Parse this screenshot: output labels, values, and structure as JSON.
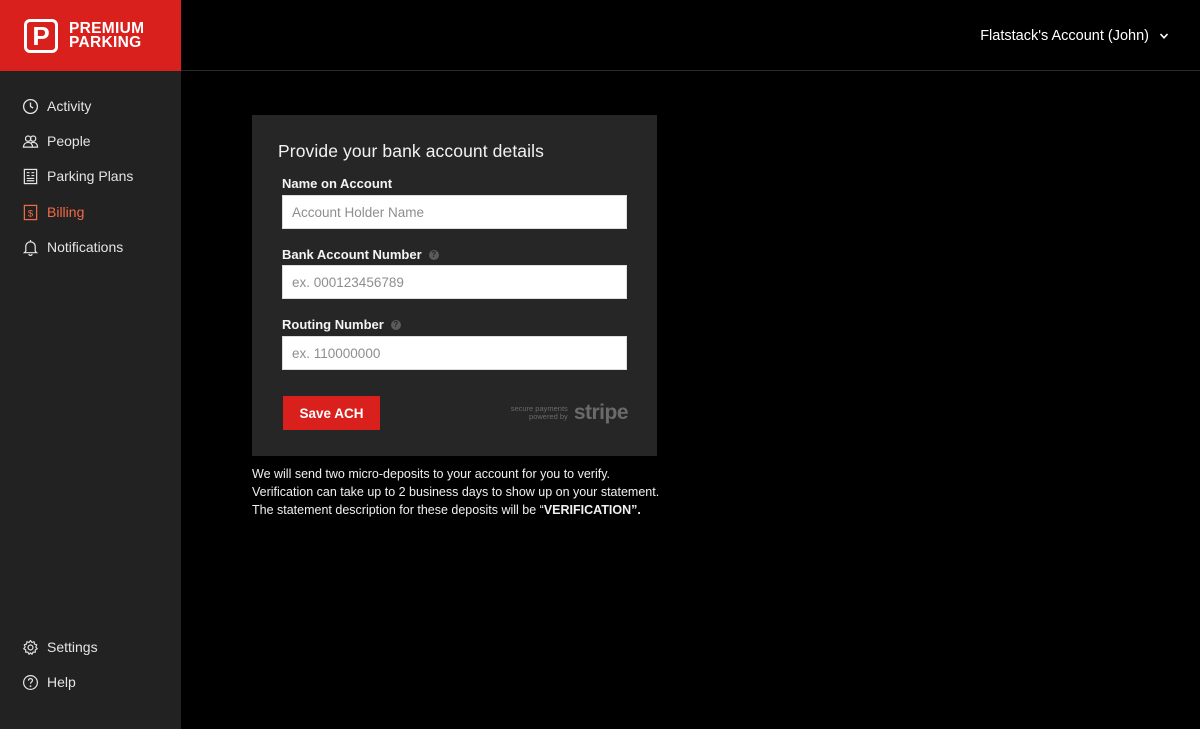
{
  "logo": {
    "mark": "P",
    "line1": "PREMIUM",
    "line2": "PARKING"
  },
  "header": {
    "account_label": "Flatstack's Account (John)"
  },
  "sidebar": {
    "items": [
      {
        "label": "Activity",
        "icon": "clock-icon"
      },
      {
        "label": "People",
        "icon": "people-icon"
      },
      {
        "label": "Parking Plans",
        "icon": "document-icon"
      },
      {
        "label": "Billing",
        "icon": "receipt-icon",
        "active": true
      },
      {
        "label": "Notifications",
        "icon": "bell-icon"
      }
    ],
    "bottom_items": [
      {
        "label": "Settings",
        "icon": "gear-icon"
      },
      {
        "label": "Help",
        "icon": "help-circle-icon"
      }
    ]
  },
  "form": {
    "title": "Provide your bank account details",
    "name": {
      "label": "Name on Account",
      "placeholder": "Account Holder Name",
      "value": ""
    },
    "account_number": {
      "label": "Bank Account Number",
      "placeholder": "ex. 000123456789",
      "value": ""
    },
    "routing_number": {
      "label": "Routing Number",
      "placeholder": "ex. 110000000",
      "value": ""
    },
    "help_glyph": "?",
    "save_label": "Save ACH",
    "stripe": {
      "line1": "secure payments",
      "line2": "powered by",
      "brand": "stripe"
    }
  },
  "note": {
    "text": "We will send two micro-deposits to your account for you to verify. Verification can take up to 2 business days to show up on your statement. The statement description for these deposits will be",
    "open_quote": "“",
    "keyword": "VERIFICATION",
    "close": "”."
  },
  "colors": {
    "brand_red": "#d9201d",
    "active_orange": "#f26a47",
    "sidebar_bg": "#222222",
    "card_bg": "#262626"
  }
}
